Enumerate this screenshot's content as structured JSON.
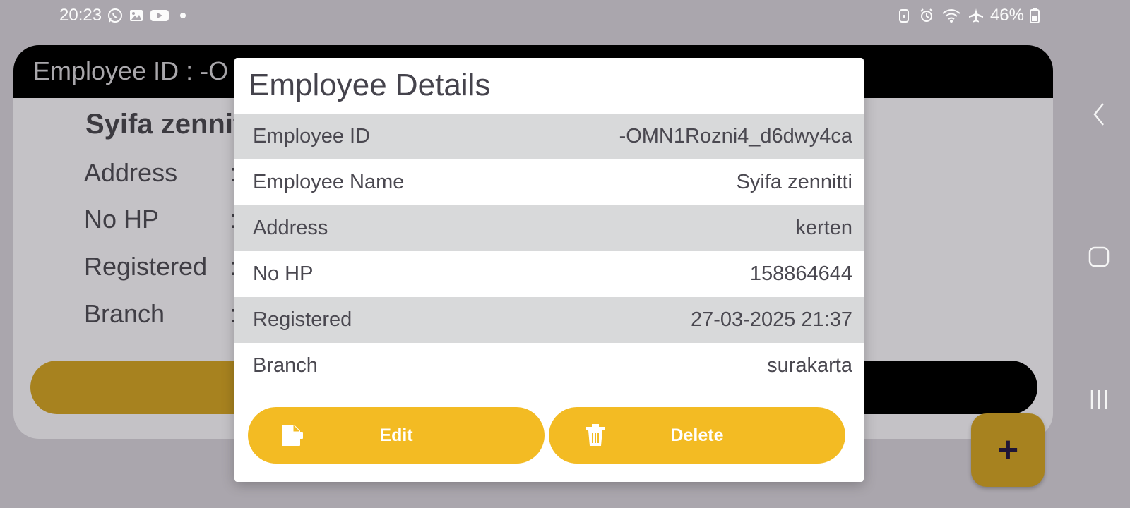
{
  "status_bar": {
    "time": "20:23",
    "left_icons": [
      "whatsapp-icon",
      "gallery-icon",
      "youtube-icon",
      "dot-icon"
    ],
    "right_icons": [
      "lock-icon",
      "alarm-icon",
      "wifi-icon",
      "airplane-icon"
    ],
    "battery": "46%"
  },
  "background_card": {
    "header_text": "Employee ID  :  -O",
    "name": "Syifa zennit",
    "labels": [
      "Address",
      "No HP",
      "Registered",
      "Branch"
    ],
    "colon": ":"
  },
  "dialog": {
    "title": "Employee Details",
    "rows": [
      {
        "label": "Employee ID",
        "value": "-OMN1Rozni4_d6dwy4ca"
      },
      {
        "label": "Employee Name",
        "value": "Syifa zennitti"
      },
      {
        "label": "Address",
        "value": "kerten"
      },
      {
        "label": "No HP",
        "value": "158864644"
      },
      {
        "label": "Registered",
        "value": "27-03-2025 21:37"
      },
      {
        "label": "Branch",
        "value": "surakarta"
      }
    ],
    "edit_label": "Edit",
    "delete_label": "Delete"
  },
  "fab": {
    "label": "+"
  },
  "colors": {
    "scrim": "#aaa6ad",
    "accent": "#f3bb23",
    "accent_dim": "#a7821f",
    "row_shade": "#d8d9da",
    "text": "#45434c"
  }
}
